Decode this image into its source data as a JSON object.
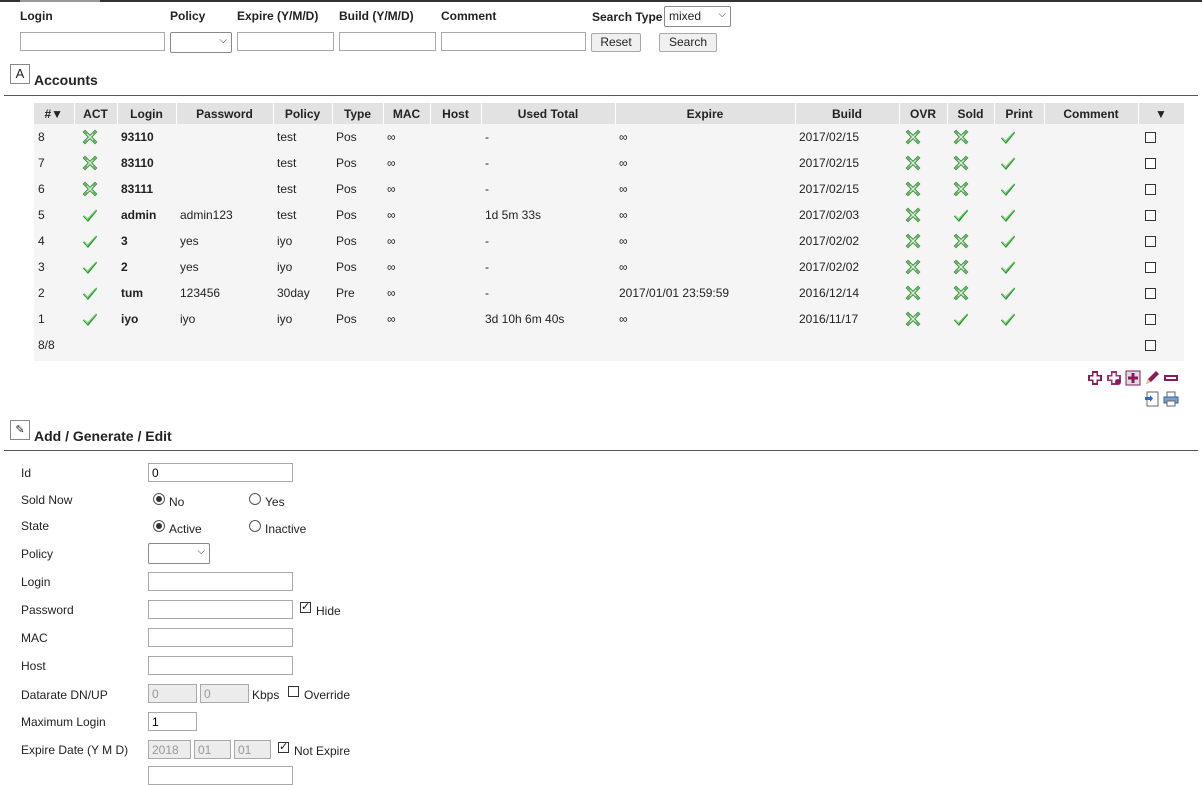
{
  "filters": {
    "login_label": "Login",
    "policy_label": "Policy",
    "expire_label": "Expire (Y/M/D)",
    "build_label": "Build (Y/M/D)",
    "comment_label": "Comment",
    "search_type_label": "Search Type",
    "search_type_value": "mixed",
    "reset_label": "Reset",
    "search_label": "Search"
  },
  "accounts": {
    "title": "Accounts",
    "columns": [
      "#▼",
      "ACT",
      "Login",
      "Password",
      "Policy",
      "Type",
      "MAC",
      "Host",
      "Used Total",
      "Expire",
      "Build",
      "OVR",
      "Sold",
      "Print",
      "Comment",
      "▼"
    ],
    "rows": [
      {
        "num": "8",
        "act": "x",
        "login": "93110",
        "password": "",
        "policy": "test",
        "type": "Pos",
        "mac": "∞",
        "host": "",
        "used": "-",
        "expire": "∞",
        "build": "2017/02/15",
        "ovr": "x",
        "sold": "x",
        "print": "check",
        "comment": ""
      },
      {
        "num": "7",
        "act": "x",
        "login": "83110",
        "password": "",
        "policy": "test",
        "type": "Pos",
        "mac": "∞",
        "host": "",
        "used": "-",
        "expire": "∞",
        "build": "2017/02/15",
        "ovr": "x",
        "sold": "x",
        "print": "check",
        "comment": ""
      },
      {
        "num": "6",
        "act": "x",
        "login": "83111",
        "password": "",
        "policy": "test",
        "type": "Pos",
        "mac": "∞",
        "host": "",
        "used": "-",
        "expire": "∞",
        "build": "2017/02/15",
        "ovr": "x",
        "sold": "x",
        "print": "check",
        "comment": ""
      },
      {
        "num": "5",
        "act": "check",
        "login": "admin",
        "password": "admin123",
        "policy": "test",
        "type": "Pos",
        "mac": "∞",
        "host": "",
        "used": "1d 5m 33s",
        "expire": "∞",
        "build": "2017/02/03",
        "ovr": "x",
        "sold": "check",
        "print": "check",
        "comment": ""
      },
      {
        "num": "4",
        "act": "check",
        "login": "3",
        "password": "yes",
        "policy": "iyo",
        "type": "Pos",
        "mac": "∞",
        "host": "",
        "used": "-",
        "expire": "∞",
        "build": "2017/02/02",
        "ovr": "x",
        "sold": "x",
        "print": "check",
        "comment": ""
      },
      {
        "num": "3",
        "act": "check",
        "login": "2",
        "password": "yes",
        "policy": "iyo",
        "type": "Pos",
        "mac": "∞",
        "host": "",
        "used": "-",
        "expire": "∞",
        "build": "2017/02/02",
        "ovr": "x",
        "sold": "x",
        "print": "check",
        "comment": ""
      },
      {
        "num": "2",
        "act": "check",
        "login": "tum",
        "password": "123456",
        "policy": "30day",
        "type": "Pre",
        "mac": "∞",
        "host": "",
        "used": "-",
        "expire": "2017/01/01 23:59:59",
        "build": "2016/12/14",
        "ovr": "x",
        "sold": "x",
        "print": "check",
        "comment": ""
      },
      {
        "num": "1",
        "act": "check",
        "login": "iyo",
        "password": "iyo",
        "policy": "iyo",
        "type": "Pos",
        "mac": "∞",
        "host": "",
        "used": "3d 10h 6m 40s",
        "expire": "∞",
        "build": "2016/11/17",
        "ovr": "x",
        "sold": "check",
        "print": "check",
        "comment": ""
      }
    ],
    "footer_count": "8/8"
  },
  "edit": {
    "title": "Add / Generate / Edit",
    "id_label": "Id",
    "id_value": "0",
    "sold_now_label": "Sold Now",
    "sold_no": "No",
    "sold_yes": "Yes",
    "state_label": "State",
    "state_active": "Active",
    "state_inactive": "Inactive",
    "policy_label": "Policy",
    "login_label": "Login",
    "password_label": "Password",
    "hide_label": "Hide",
    "mac_label": "MAC",
    "host_label": "Host",
    "datarate_label": "Datarate DN/UP",
    "dn_value": "0",
    "up_value": "0",
    "kbps_label": "Kbps",
    "override_label": "Override",
    "max_login_label": "Maximum Login",
    "max_login_value": "1",
    "expire_date_label": "Expire Date (Y M D)",
    "exp_y": "2018",
    "exp_m": "01",
    "exp_d": "01",
    "not_expire_label": "Not Expire"
  },
  "colors": {
    "check_green": "#2e9a2e",
    "x_green": "#5fae5f",
    "action_purple": "#8b1a5a",
    "header_bg": "#e2e2e2"
  }
}
